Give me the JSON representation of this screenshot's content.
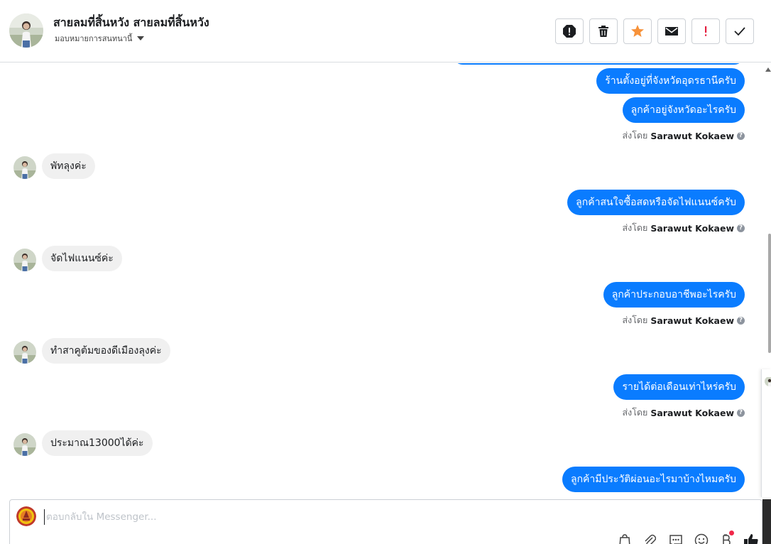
{
  "header": {
    "contact_name": "สายลมที่สิ้นหวัง สายลมที่สิ้นหวัง",
    "assign_label": "มอบหมายการสนทนานี้"
  },
  "toolbar": {
    "icons": [
      "spam-icon",
      "trash-icon",
      "star-icon",
      "envelope-icon",
      "follow-up-icon",
      "check-icon"
    ],
    "star_color": "#f7923a",
    "follow_up_color": "#e41e3f"
  },
  "messages": [
    {
      "direction": "out",
      "text": "ร้านตั้งอยู่ที่จังหวัดอุดรธานีครับ"
    },
    {
      "direction": "out",
      "text": "ลูกค้าอยู่จังหวัดอะไรครับ"
    },
    {
      "type": "sent_by",
      "prefix": "ส่งโดย",
      "sender": "Sarawut Kokaew"
    },
    {
      "direction": "in",
      "text": "พัทลุงค่ะ"
    },
    {
      "direction": "out",
      "text": "ลูกค้าสนใจซื้อสดหรือจัดไฟแนนซ์ครับ"
    },
    {
      "type": "sent_by",
      "prefix": "ส่งโดย",
      "sender": "Sarawut Kokaew"
    },
    {
      "direction": "in",
      "text": "จัดไฟแนนซ์ค่ะ"
    },
    {
      "direction": "out",
      "text": "ลูกค้าประกอบอาชีพอะไรครับ"
    },
    {
      "type": "sent_by",
      "prefix": "ส่งโดย",
      "sender": "Sarawut Kokaew"
    },
    {
      "direction": "in",
      "text": "ทำสาคูต้มของดีเมืองลุงค่ะ"
    },
    {
      "direction": "out",
      "text": "รายได้ต่อเดือนเท่าไหร่ครับ"
    },
    {
      "type": "sent_by",
      "prefix": "ส่งโดย",
      "sender": "Sarawut Kokaew"
    },
    {
      "direction": "in",
      "text": "ประมาณ13000ได้ค่ะ"
    },
    {
      "direction": "out",
      "text": "ลูกค้ามีประวัติผ่อนอะไรมาบ้างไหมครับ"
    }
  ],
  "composer": {
    "placeholder": "ตอบกลับใน Messenger...",
    "tools": [
      "bag-icon",
      "paperclip-icon",
      "saved-reply-icon",
      "emoji-icon",
      "bitcoin-icon",
      "like-icon"
    ]
  },
  "colors": {
    "outgoing_bubble": "#0a7cff",
    "incoming_bubble": "#f0f0f0"
  }
}
